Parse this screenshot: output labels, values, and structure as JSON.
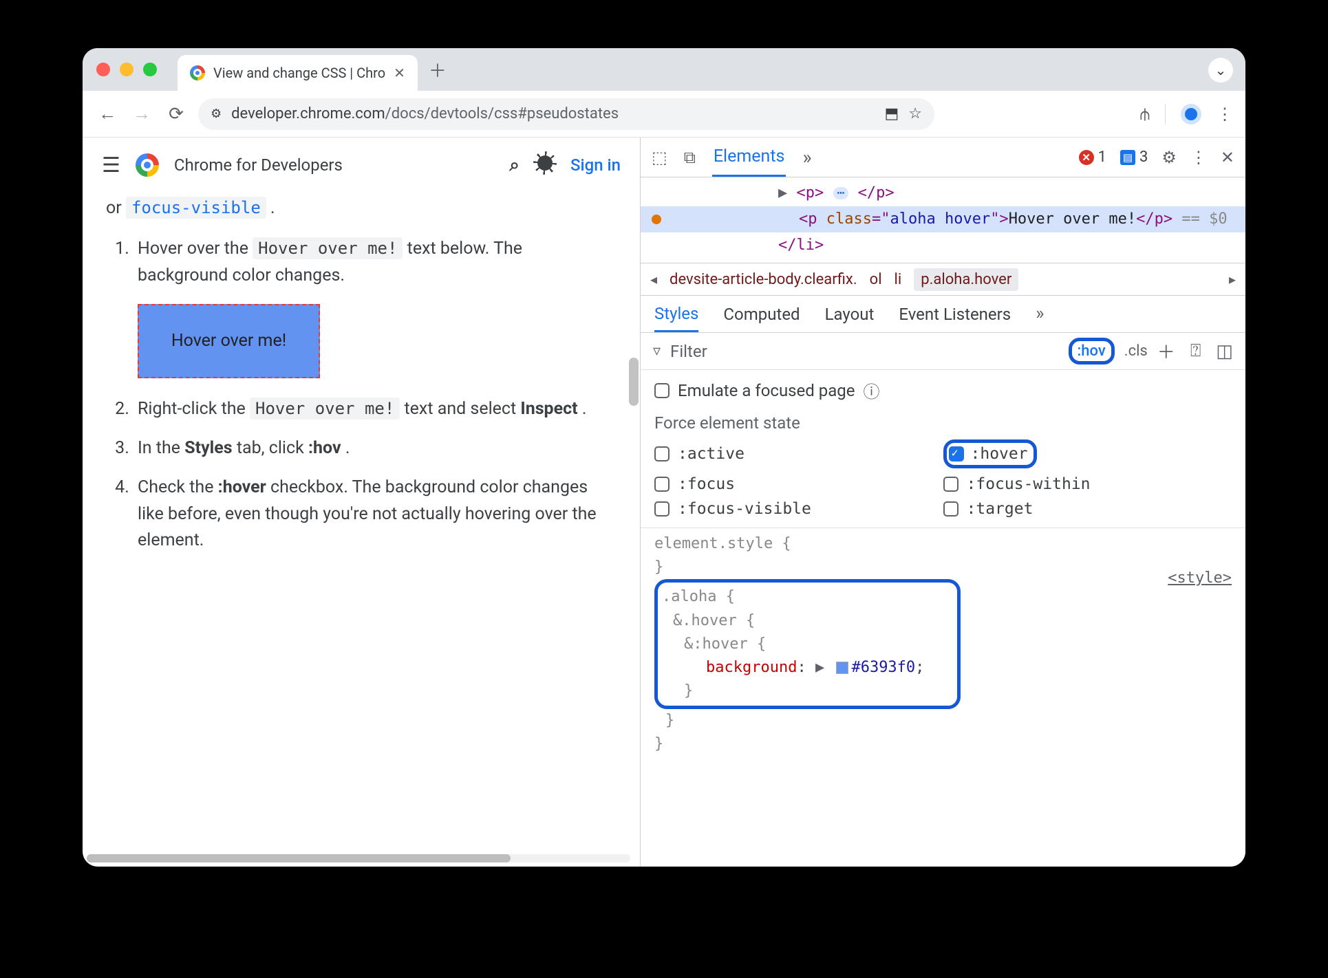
{
  "browser": {
    "tab_title": "View and change CSS  |  Chro",
    "url_host": "developer.chrome.com",
    "url_path": "/docs/devtools/css#pseudostates"
  },
  "page": {
    "brand": "Chrome for Developers",
    "signin": "Sign in",
    "intro_tail": "or ",
    "intro_code": "focus-visible",
    "intro_period": ".",
    "steps": {
      "s1_a": "Hover over the ",
      "s1_code": "Hover over me!",
      "s1_b": " text below. The background color changes.",
      "demo_text": "Hover over me!",
      "s2_a": "Right-click the ",
      "s2_code": "Hover over me!",
      "s2_b": " text and select ",
      "s2_strong": "Inspect",
      "s2_c": ".",
      "s3_a": "In the ",
      "s3_strong1": "Styles",
      "s3_b": " tab, click ",
      "s3_strong2": ":hov",
      "s3_c": ".",
      "s4_a": "Check the ",
      "s4_strong": ":hover",
      "s4_b": " checkbox. The background color changes like before, even though you're not actually hovering over the element."
    }
  },
  "devtools": {
    "top_tab": "Elements",
    "errors": "1",
    "messages": "3",
    "dom": {
      "l1_open": "<p>",
      "l1_close": "</p>",
      "l2_open": "<p ",
      "l2_attr": "class",
      "l2_eq": "=\"",
      "l2_val": "aloha hover",
      "l2_close_attr": "\">",
      "l2_text": "Hover over me!",
      "l2_end": "</p>",
      "l2_sel": " == $0",
      "l3": "</li>"
    },
    "breadcrumb": {
      "b1": "devsite-article-body.clearfix.",
      "b2": "ol",
      "b3": "li",
      "b4": "p.aloha.hover"
    },
    "tabs": {
      "styles": "Styles",
      "computed": "Computed",
      "layout": "Layout",
      "listeners": "Event Listeners"
    },
    "filter": {
      "placeholder": "Filter",
      "hov": ":hov",
      "cls": ".cls"
    },
    "emulate": "Emulate a focused page",
    "force_title": "Force element state",
    "states": {
      "active": ":active",
      "hover": ":hover",
      "focus": ":focus",
      "focus_within": ":focus-within",
      "focus_visible": ":focus-visible",
      "target": ":target"
    },
    "rules": {
      "elstyle": "element.style {",
      "close": "}",
      "aloha": ".aloha {",
      "nest_hover": "&.hover {",
      "nest_pseudo": "&:hover {",
      "prop": "background",
      "colon": ": ",
      "tri": "▶",
      "value": "#6393f0",
      "semi": ";",
      "source": "<style>"
    }
  }
}
